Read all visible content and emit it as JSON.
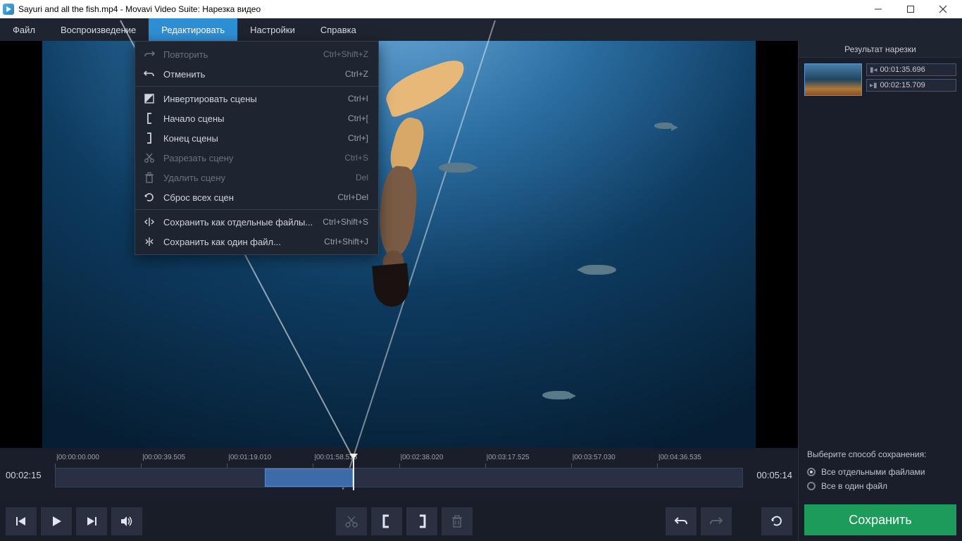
{
  "window": {
    "title": "Sayuri and all the fish.mp4 - Movavi Video Suite: Нарезка видео"
  },
  "menubar": {
    "items": [
      "Файл",
      "Воспроизведение",
      "Редактировать",
      "Настройки",
      "Справка"
    ],
    "active_index": 2
  },
  "dropdown": {
    "groups": [
      [
        {
          "icon": "redo",
          "label": "Повторить",
          "shortcut": "Ctrl+Shift+Z",
          "disabled": true
        },
        {
          "icon": "undo",
          "label": "Отменить",
          "shortcut": "Ctrl+Z",
          "disabled": false
        }
      ],
      [
        {
          "icon": "invert",
          "label": "Инвертировать сцены",
          "shortcut": "Ctrl+I",
          "disabled": false
        },
        {
          "icon": "bracket-open",
          "label": "Начало сцены",
          "shortcut": "Ctrl+[",
          "disabled": false
        },
        {
          "icon": "bracket-close",
          "label": "Конец сцены",
          "shortcut": "Ctrl+]",
          "disabled": false
        },
        {
          "icon": "scissors",
          "label": "Разрезать сцену",
          "shortcut": "Ctrl+S",
          "disabled": true
        },
        {
          "icon": "trash",
          "label": "Удалить сцену",
          "shortcut": "Del",
          "disabled": true
        },
        {
          "icon": "reset",
          "label": "Сброс всех сцен",
          "shortcut": "Ctrl+Del",
          "disabled": false
        }
      ],
      [
        {
          "icon": "split-multi",
          "label": "Сохранить как отдельные файлы...",
          "shortcut": "Ctrl+Shift+S",
          "disabled": false
        },
        {
          "icon": "split-one",
          "label": "Сохранить как один файл...",
          "shortcut": "Ctrl+Shift+J",
          "disabled": false
        }
      ]
    ]
  },
  "right_panel": {
    "title": "Результат нарезки",
    "items": [
      {
        "start": "00:01:35.696",
        "end": "00:02:15.709"
      }
    ]
  },
  "timeline": {
    "current": "00:02:15",
    "duration": "00:05:14",
    "ticks": [
      "00:00:00.000",
      "00:00:39.505",
      "00:01:19.010",
      "00:01:58.515",
      "00:02:38.020",
      "00:03:17.525",
      "00:03:57.030",
      "00:04:36.535"
    ],
    "clip": {
      "start_pct": 30.5,
      "end_pct": 43.3
    },
    "playhead_pct": 43.3
  },
  "save_options": {
    "heading": "Выберите способ сохранения:",
    "options": [
      {
        "label": "Все отдельными файлами",
        "checked": true
      },
      {
        "label": "Все в один файл",
        "checked": false
      }
    ]
  },
  "save_button": "Сохранить"
}
